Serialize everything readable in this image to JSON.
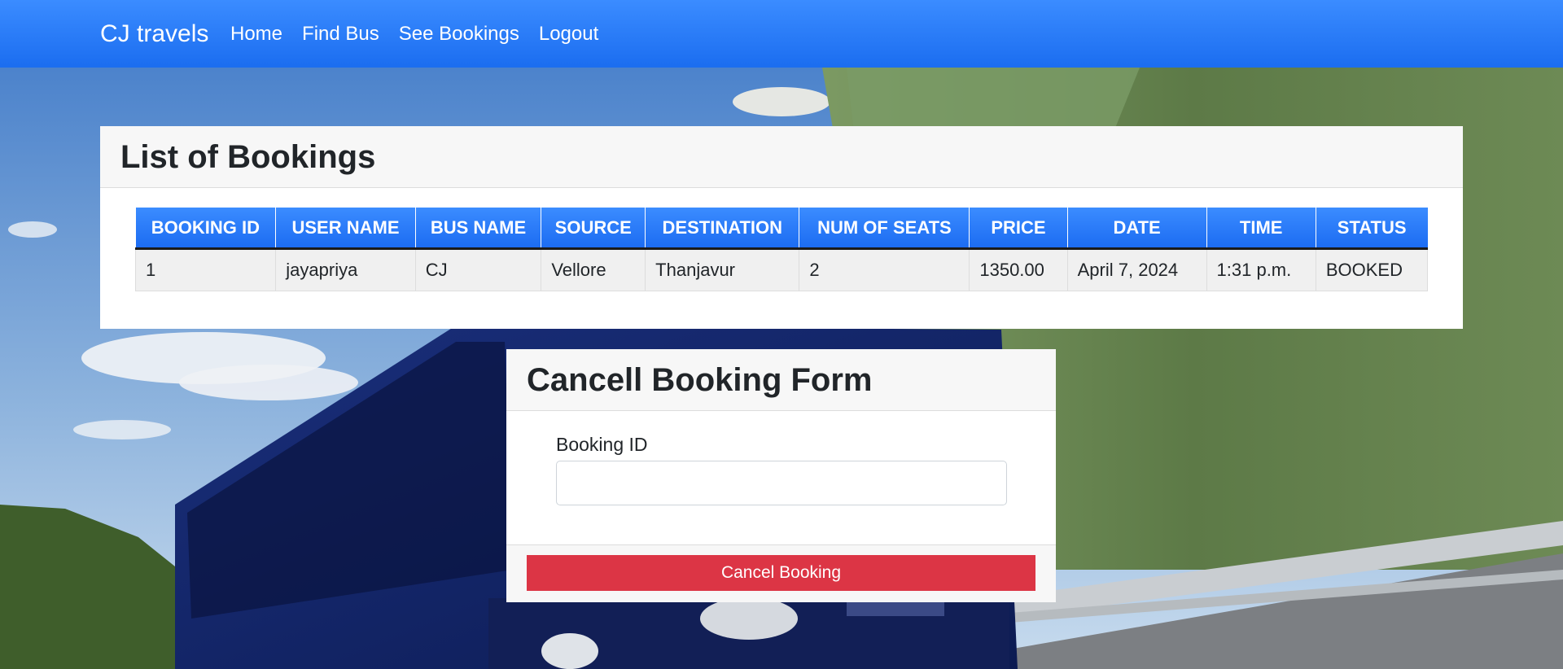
{
  "navbar": {
    "brand": "CJ travels",
    "links": [
      "Home",
      "Find Bus",
      "See Bookings",
      "Logout"
    ]
  },
  "bookings": {
    "title": "List of Bookings",
    "columns": [
      "BOOKING ID",
      "USER NAME",
      "BUS NAME",
      "SOURCE",
      "DESTINATION",
      "NUM OF SEATS",
      "PRICE",
      "DATE",
      "TIME",
      "STATUS"
    ],
    "rows": [
      [
        "1",
        "jayapriya",
        "CJ",
        "Vellore",
        "Thanjavur",
        "2",
        "1350.00",
        "April 7, 2024",
        "1:31 p.m.",
        "BOOKED"
      ]
    ]
  },
  "cancel_form": {
    "title": "Cancell Booking Form",
    "field_label": "Booking ID",
    "field_value": "",
    "submit_label": "Cancel Booking"
  },
  "colors": {
    "navbar": "#1b6df0",
    "table_header": "#1c6cf2",
    "danger": "#dc3545"
  }
}
